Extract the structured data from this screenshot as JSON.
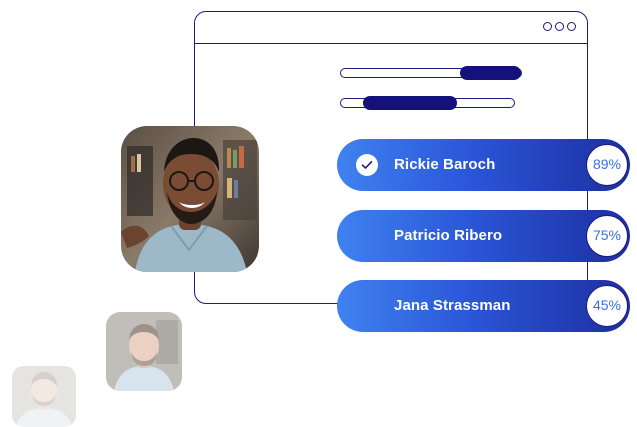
{
  "window": {
    "controls": [
      "circle",
      "circle",
      "circle"
    ]
  },
  "sliders": [
    {
      "fill_start": 0.66,
      "fill_end": 1.0
    },
    {
      "fill_start": 0.13,
      "fill_end": 0.67
    }
  ],
  "candidates": [
    {
      "name": "Rickie Baroch",
      "score": "89%",
      "selected": true
    },
    {
      "name": "Patricio Ribero",
      "score": "75%",
      "selected": false
    },
    {
      "name": "Jana Strassman",
      "score": "45%",
      "selected": false
    }
  ],
  "icons": {
    "check": "check-icon",
    "window_control": "circle-icon"
  },
  "colors": {
    "outline": "#1b1a7e",
    "slider_fill": "#14127a",
    "pill_start": "#3f82f0",
    "pill_end": "#1c2fa0",
    "score_text": "#3a6fe6"
  }
}
